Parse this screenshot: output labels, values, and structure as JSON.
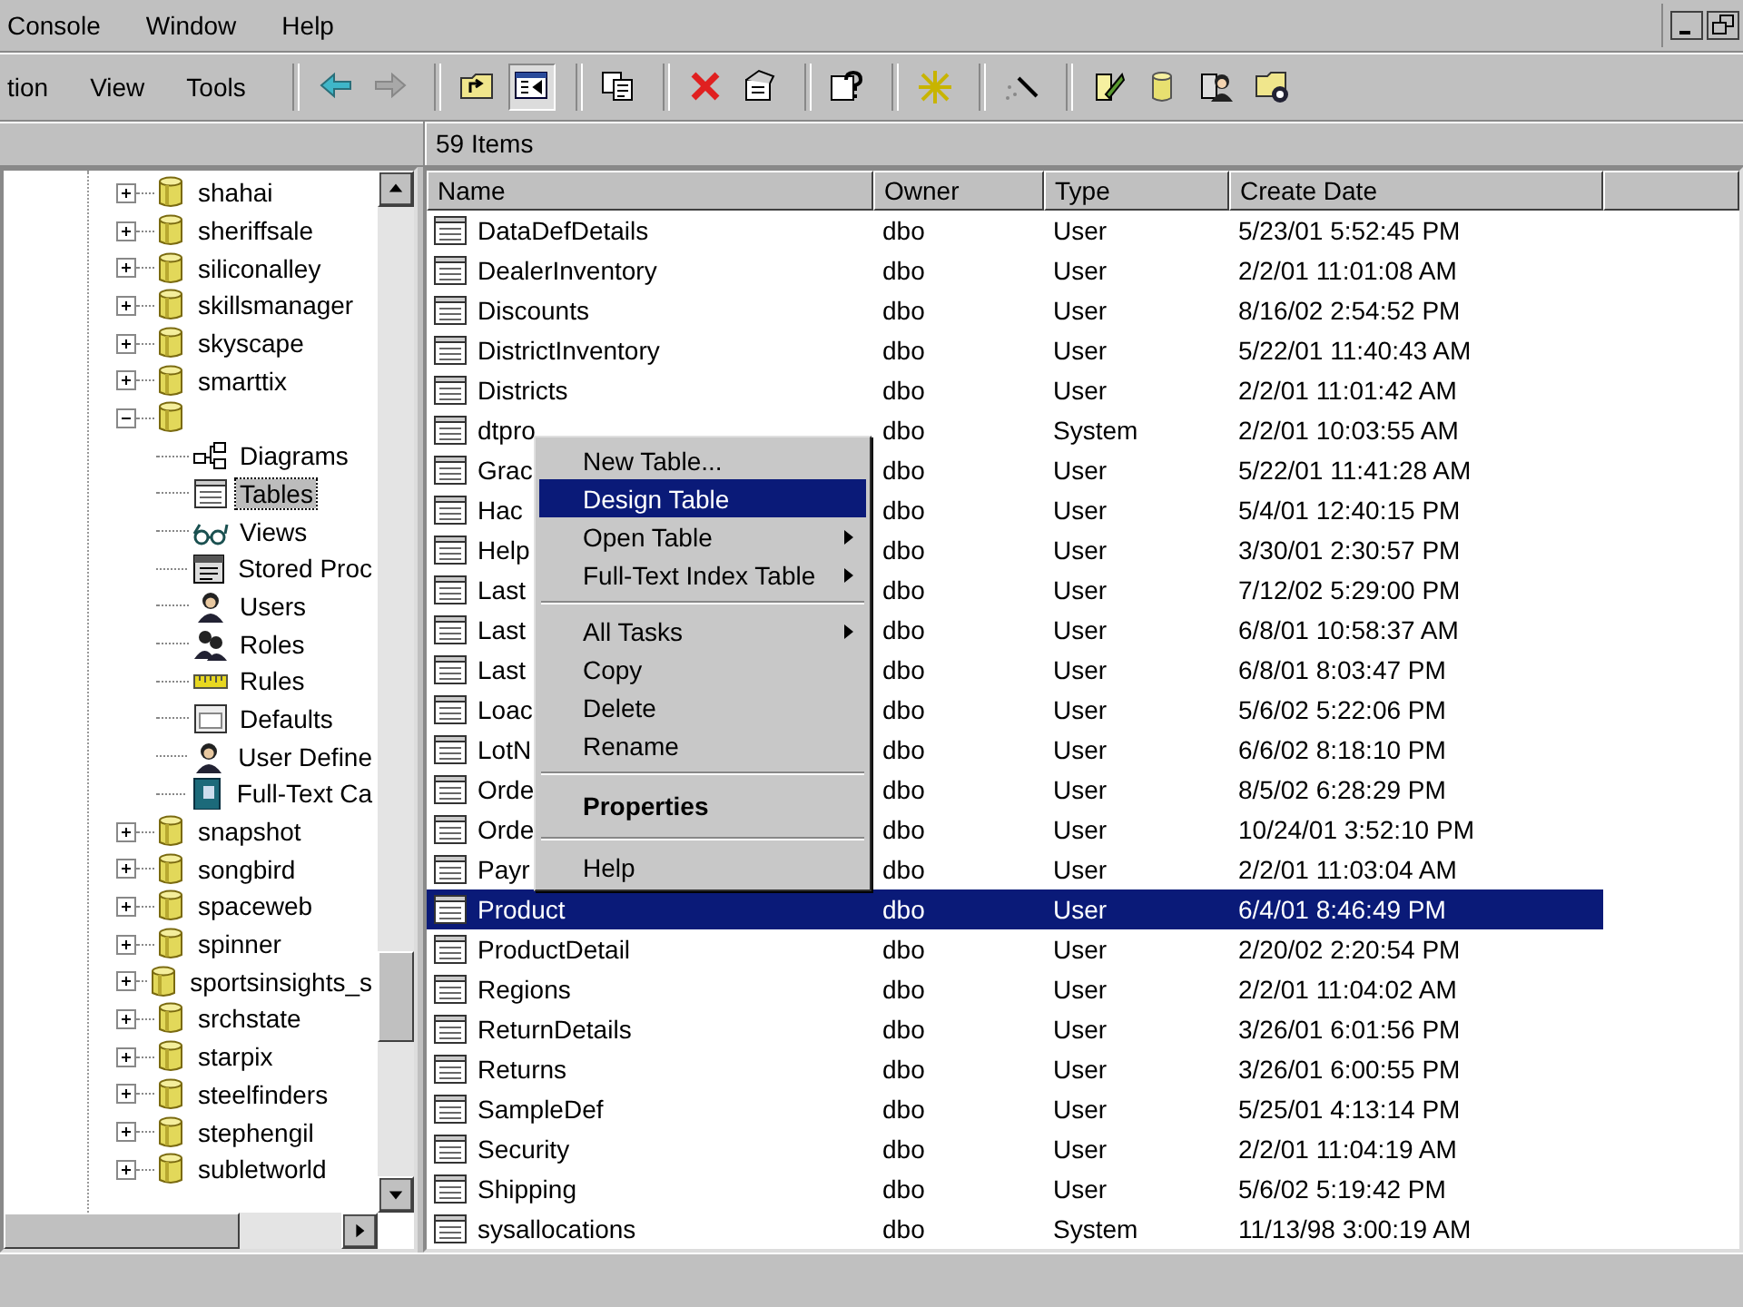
{
  "menu_bar": [
    "Console",
    "Window",
    "Help"
  ],
  "toolbar": {
    "menus": [
      "tion",
      "View",
      "Tools"
    ],
    "buttons": [
      {
        "kind": "back",
        "pressed": false
      },
      {
        "kind": "forward",
        "pressed": false
      },
      {
        "kind": "up",
        "pressed": false
      },
      {
        "kind": "panel",
        "pressed": true
      },
      {
        "kind": "copy",
        "pressed": false
      },
      {
        "kind": "delete",
        "pressed": false
      },
      {
        "kind": "properties",
        "pressed": false
      },
      {
        "kind": "help",
        "pressed": false
      },
      {
        "kind": "sparkle",
        "pressed": false
      },
      {
        "kind": "wand",
        "pressed": false
      },
      {
        "kind": "script",
        "pressed": false
      },
      {
        "kind": "database",
        "pressed": false
      },
      {
        "kind": "users",
        "pressed": false
      },
      {
        "kind": "job",
        "pressed": false
      }
    ]
  },
  "list_header": "59 Items",
  "tree": [
    {
      "label": "shahai",
      "kind": "database",
      "expanded": false,
      "selected": false
    },
    {
      "label": "sheriffsale",
      "kind": "database",
      "expanded": false,
      "selected": false
    },
    {
      "label": "siliconalley",
      "kind": "database",
      "expanded": false,
      "selected": false
    },
    {
      "label": "skillsmanager",
      "kind": "database",
      "expanded": false,
      "selected": false
    },
    {
      "label": "skyscape",
      "kind": "database",
      "expanded": false,
      "selected": false
    },
    {
      "label": "smarttix",
      "kind": "database",
      "expanded": false,
      "selected": false
    },
    {
      "kind": "database",
      "expanded": true,
      "selected": false,
      "children": [
        {
          "label": "Diagrams",
          "kind": "diagram",
          "selected": false
        },
        {
          "label": "Tables",
          "kind": "table",
          "selected": true
        },
        {
          "label": "Views",
          "kind": "view",
          "selected": false
        },
        {
          "label": "Stored Proc",
          "kind": "procedure",
          "selected": false
        },
        {
          "label": "Users",
          "kind": "user",
          "selected": false
        },
        {
          "label": "Roles",
          "kind": "role",
          "selected": false
        },
        {
          "label": "Rules",
          "kind": "rule",
          "selected": false
        },
        {
          "label": "Defaults",
          "kind": "default",
          "selected": false
        },
        {
          "label": "User Define",
          "kind": "user",
          "selected": false
        },
        {
          "label": "Full-Text Ca",
          "kind": "catalog",
          "selected": false
        }
      ]
    },
    {
      "label": "snapshot",
      "kind": "database",
      "expanded": false,
      "selected": false
    },
    {
      "label": "songbird",
      "kind": "database",
      "expanded": false,
      "selected": false
    },
    {
      "label": "spaceweb",
      "kind": "database",
      "expanded": false,
      "selected": false
    },
    {
      "label": "spinner",
      "kind": "database",
      "expanded": false,
      "selected": false
    },
    {
      "label": "sportsinsights_s",
      "kind": "database",
      "expanded": false,
      "selected": false
    },
    {
      "label": "srchstate",
      "kind": "database",
      "expanded": false,
      "selected": false
    },
    {
      "label": "starpix",
      "kind": "database",
      "expanded": false,
      "selected": false
    },
    {
      "label": "steelfinders",
      "kind": "database",
      "expanded": false,
      "selected": false
    },
    {
      "label": "stephengil",
      "kind": "database",
      "expanded": false,
      "selected": false
    },
    {
      "label": "subletworld",
      "kind": "database",
      "expanded": false,
      "selected": false
    }
  ],
  "table": {
    "columns": [
      "Name",
      "Owner",
      "Type",
      "Create Date"
    ],
    "rows": [
      {
        "cells": [
          "DataDefDetails",
          "dbo",
          "User",
          "5/23/01 5:52:45 PM"
        ],
        "selected": false
      },
      {
        "cells": [
          "DealerInventory",
          "dbo",
          "User",
          "2/2/01 11:01:08 AM"
        ],
        "selected": false
      },
      {
        "cells": [
          "Discounts",
          "dbo",
          "User",
          "8/16/02 2:54:52 PM"
        ],
        "selected": false
      },
      {
        "cells": [
          "DistrictInventory",
          "dbo",
          "User",
          "5/22/01 11:40:43 AM"
        ],
        "selected": false
      },
      {
        "cells": [
          "Districts",
          "dbo",
          "User",
          "2/2/01 11:01:42 AM"
        ],
        "selected": false
      },
      {
        "cells": [
          "dtpro",
          "dbo",
          "System",
          "2/2/01 10:03:55 AM"
        ],
        "selected": false
      },
      {
        "cells": [
          "Grac",
          "dbo",
          "User",
          "5/22/01 11:41:28 AM"
        ],
        "selected": false
      },
      {
        "cells": [
          "Hac",
          "dbo",
          "User",
          "5/4/01 12:40:15 PM"
        ],
        "selected": false
      },
      {
        "cells": [
          "Help",
          "dbo",
          "User",
          "3/30/01 2:30:57 PM"
        ],
        "selected": false
      },
      {
        "cells": [
          "Last",
          "dbo",
          "User",
          "7/12/02 5:29:00 PM"
        ],
        "selected": false
      },
      {
        "cells": [
          "Last",
          "dbo",
          "User",
          "6/8/01 10:58:37 AM"
        ],
        "selected": false
      },
      {
        "cells": [
          "Last",
          "dbo",
          "User",
          "6/8/01 8:03:47 PM"
        ],
        "selected": false
      },
      {
        "cells": [
          "Loac",
          "dbo",
          "User",
          "5/6/02 5:22:06 PM"
        ],
        "selected": false
      },
      {
        "cells": [
          "LotN",
          "dbo",
          "User",
          "6/6/02 8:18:10 PM"
        ],
        "selected": false
      },
      {
        "cells": [
          "Orde",
          "dbo",
          "User",
          "8/5/02 6:28:29 PM"
        ],
        "selected": false
      },
      {
        "cells": [
          "Orde",
          "dbo",
          "User",
          "10/24/01 3:52:10 PM"
        ],
        "selected": false
      },
      {
        "cells": [
          "Payr",
          "dbo",
          "User",
          "2/2/01 11:03:04 AM"
        ],
        "selected": false
      },
      {
        "cells": [
          "Product",
          "dbo",
          "User",
          "6/4/01 8:46:49 PM"
        ],
        "selected": true
      },
      {
        "cells": [
          "ProductDetail",
          "dbo",
          "User",
          "2/20/02 2:20:54 PM"
        ],
        "selected": false
      },
      {
        "cells": [
          "Regions",
          "dbo",
          "User",
          "2/2/01 11:04:02 AM"
        ],
        "selected": false
      },
      {
        "cells": [
          "ReturnDetails",
          "dbo",
          "User",
          "3/26/01 6:01:56 PM"
        ],
        "selected": false
      },
      {
        "cells": [
          "Returns",
          "dbo",
          "User",
          "3/26/01 6:00:55 PM"
        ],
        "selected": false
      },
      {
        "cells": [
          "SampleDef",
          "dbo",
          "User",
          "5/25/01 4:13:14 PM"
        ],
        "selected": false
      },
      {
        "cells": [
          "Security",
          "dbo",
          "User",
          "2/2/01 11:04:19 AM"
        ],
        "selected": false
      },
      {
        "cells": [
          "Shipping",
          "dbo",
          "User",
          "5/6/02 5:19:42 PM"
        ],
        "selected": false
      },
      {
        "cells": [
          "sysallocations",
          "dbo",
          "System",
          "11/13/98 3:00:19 AM"
        ],
        "selected": false
      }
    ]
  },
  "context_menu": [
    {
      "kind": "item",
      "label": "New Table...",
      "selected": false,
      "submenu": false,
      "bold": false
    },
    {
      "kind": "item",
      "label": "Design Table",
      "selected": true,
      "submenu": false,
      "bold": false
    },
    {
      "kind": "item",
      "label": "Open Table",
      "selected": false,
      "submenu": true,
      "bold": false
    },
    {
      "kind": "item",
      "label": "Full-Text Index Table",
      "selected": false,
      "submenu": true,
      "bold": false
    },
    {
      "kind": "separator"
    },
    {
      "kind": "item",
      "label": "All Tasks",
      "selected": false,
      "submenu": true,
      "bold": false
    },
    {
      "kind": "item",
      "label": "Copy",
      "selected": false,
      "submenu": false,
      "bold": false
    },
    {
      "kind": "item",
      "label": "Delete",
      "selected": false,
      "submenu": false,
      "bold": false
    },
    {
      "kind": "item",
      "label": "Rename",
      "selected": false,
      "submenu": false,
      "bold": false
    },
    {
      "kind": "separator"
    },
    {
      "kind": "item",
      "label": "Properties",
      "selected": false,
      "submenu": false,
      "bold": true
    },
    {
      "kind": "separator"
    },
    {
      "kind": "item",
      "label": "Help",
      "selected": false,
      "submenu": false,
      "bold": false
    }
  ]
}
